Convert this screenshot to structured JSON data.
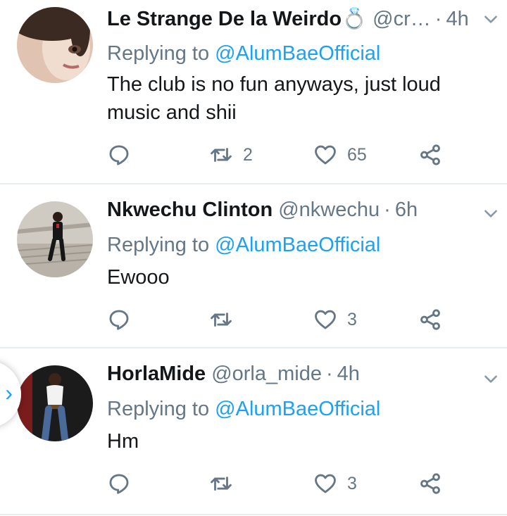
{
  "colors": {
    "accent": "#1da1f2",
    "muted": "#657786",
    "text": "#14171a",
    "divider": "#e6ecf0"
  },
  "icons": {
    "reply": "reply-icon",
    "retweet": "retweet-icon",
    "like": "heart-icon",
    "share": "share-icon",
    "menu": "chevron-down-icon",
    "side_tab": "chevron-right-icon"
  },
  "side_tab": {
    "glyph": "›"
  },
  "tweets": [
    {
      "name": "Le Strange De la Weirdo💍",
      "handle": "@cr…",
      "sep": "·",
      "time": "4h",
      "replying_label": "Replying to",
      "replying_to": "@AlumBaeOfficial",
      "text": "The club is no fun anyways, just loud music and shii",
      "retweets": "2",
      "likes": "65"
    },
    {
      "name": "Nkwechu Clinton",
      "handle": "@nkwechu",
      "sep": "·",
      "time": "6h",
      "replying_label": "Replying to",
      "replying_to": "@AlumBaeOfficial",
      "text": "Ewooo",
      "retweets": "",
      "likes": "3"
    },
    {
      "name": "HorlaMide",
      "handle": "@orla_mide",
      "sep": "·",
      "time": "4h",
      "replying_label": "Replying to",
      "replying_to": "@AlumBaeOfficial",
      "text": "Hm",
      "retweets": "",
      "likes": "3"
    }
  ]
}
